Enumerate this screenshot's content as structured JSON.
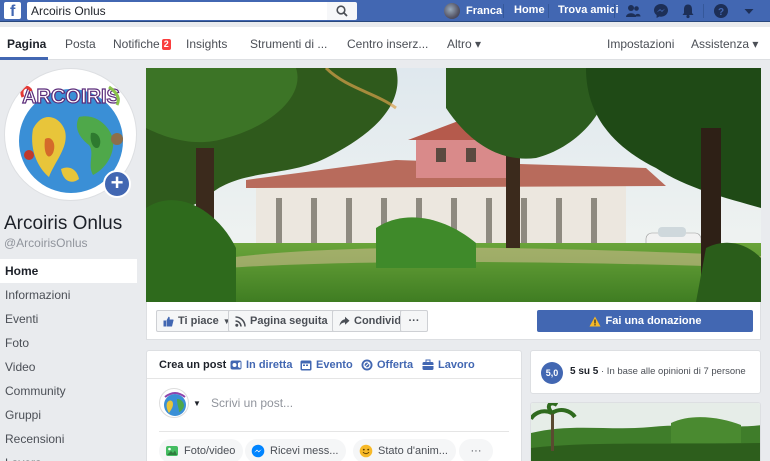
{
  "topbar": {
    "search_value": "Arcoiris Onlus",
    "user_name": "Franca",
    "home_label": "Home",
    "find_friends_label": "Trova amici",
    "colors": {
      "bar": "#4267b2"
    }
  },
  "pagenav": {
    "items": [
      "Pagina",
      "Posta",
      "Notifiche",
      "Insights",
      "Strumenti di ...",
      "Centro inserz...",
      "Altro ▾"
    ],
    "notifications_count": "2",
    "right_items": [
      "Impostazioni",
      "Assistenza ▾"
    ]
  },
  "sidebar": {
    "logo_text": "ARCOIRIS",
    "page_name": "Arcoiris Onlus",
    "page_handle": "@ArcoirisOnlus",
    "items": [
      "Home",
      "Informazioni",
      "Eventi",
      "Foto",
      "Video",
      "Community",
      "Gruppi",
      "Recensioni",
      "Lavora"
    ]
  },
  "actions": {
    "like_label": "Ti piace",
    "follow_label": "Pagina seguita",
    "share_label": "Condividi",
    "more_label": "···",
    "donate_label": "Fai una donazione"
  },
  "composer": {
    "tabs": [
      "Crea un post",
      "In diretta",
      "Evento",
      "Offerta",
      "Lavoro"
    ],
    "placeholder": "Scrivi un post...",
    "pills": [
      "Foto/video",
      "Ricevi mess...",
      "Stato d'anim...",
      "···"
    ]
  },
  "rating": {
    "score": "5,0",
    "summary": "5 su 5",
    "detail": " · In base alle opinioni di 7 persone"
  }
}
